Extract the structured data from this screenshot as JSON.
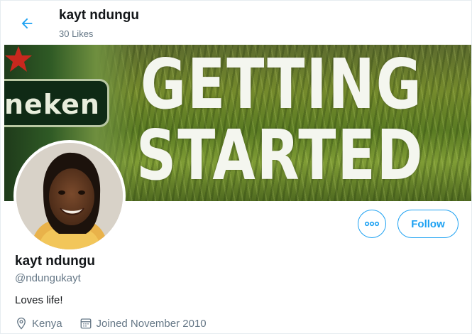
{
  "header": {
    "back_icon": "arrow-left-icon",
    "name": "kayt ndungu",
    "likes": "30 Likes"
  },
  "banner": {
    "text_line1": "GETTING",
    "text_line2": "STARTED",
    "beer_label": "neken"
  },
  "actions": {
    "more_icon": "ellipsis-icon",
    "follow_label": "Follow"
  },
  "profile": {
    "name": "kayt ndungu",
    "handle": "@ndungukayt",
    "bio": "Loves life!",
    "location": "Kenya",
    "joined": "Joined November 2010"
  },
  "colors": {
    "accent": "#1da1f2",
    "secondary_text": "#657786",
    "primary_text": "#14171a"
  }
}
